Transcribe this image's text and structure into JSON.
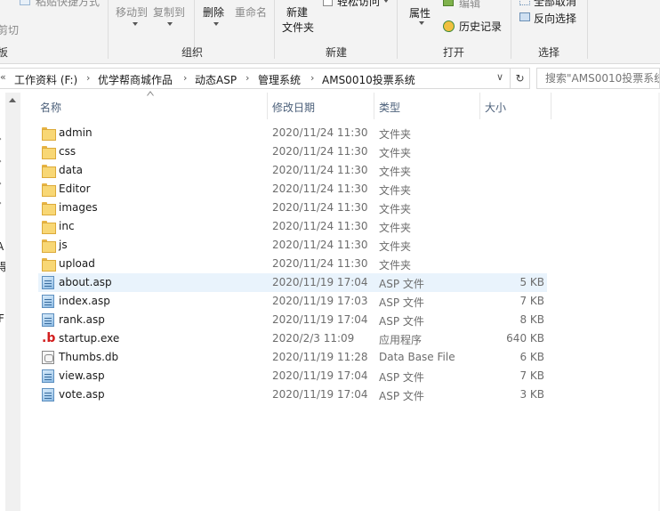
{
  "ribbon": {
    "partial_top_left": "粘贴快捷方式",
    "partial_left_cut": "剪切",
    "partial_left_board": "板",
    "move_to": "移动到",
    "copy_to": "复制到",
    "delete": "删除",
    "rename": "重命名",
    "new_folder_1": "新建",
    "new_folder_2": "文件夹",
    "new_item_partial": "轻松访问",
    "properties": "属性",
    "edit_partial": "编辑",
    "history": "历史记录",
    "select_all_partial": "全部取消",
    "invert_selection": "反向选择",
    "groups": {
      "organize": "组织",
      "new": "新建",
      "open": "打开",
      "select": "选择"
    }
  },
  "address": {
    "prefix": "«",
    "crumbs": [
      "工作资料 (F:)",
      "优学帮商城作品",
      "动态ASP",
      "管理系统",
      "AMS0010投票系统"
    ],
    "separator": "›",
    "dropdown": "∨",
    "refresh": "↻",
    "search_placeholder": "搜索\"AMS0010投票系统"
  },
  "nav": {
    "partial_labels": [
      "A",
      "得",
      "F"
    ]
  },
  "columns": {
    "name": "名称",
    "date": "修改日期",
    "type": "类型",
    "size": "大小"
  },
  "files": [
    {
      "name": "admin",
      "date": "2020/11/24 11:30",
      "type": "文件夹",
      "size": "",
      "icon": "folder-icon"
    },
    {
      "name": "css",
      "date": "2020/11/24 11:30",
      "type": "文件夹",
      "size": "",
      "icon": "folder-icon"
    },
    {
      "name": "data",
      "date": "2020/11/24 11:30",
      "type": "文件夹",
      "size": "",
      "icon": "folder-icon"
    },
    {
      "name": "Editor",
      "date": "2020/11/24 11:30",
      "type": "文件夹",
      "size": "",
      "icon": "folder-icon"
    },
    {
      "name": "images",
      "date": "2020/11/24 11:30",
      "type": "文件夹",
      "size": "",
      "icon": "folder-icon"
    },
    {
      "name": "inc",
      "date": "2020/11/24 11:30",
      "type": "文件夹",
      "size": "",
      "icon": "folder-icon"
    },
    {
      "name": "js",
      "date": "2020/11/24 11:30",
      "type": "文件夹",
      "size": "",
      "icon": "folder-icon"
    },
    {
      "name": "upload",
      "date": "2020/11/24 11:30",
      "type": "文件夹",
      "size": "",
      "icon": "folder-icon"
    },
    {
      "name": "about.asp",
      "date": "2020/11/19 17:04",
      "type": "ASP 文件",
      "size": "5 KB",
      "icon": "asp-file-icon"
    },
    {
      "name": "index.asp",
      "date": "2020/11/19 17:03",
      "type": "ASP 文件",
      "size": "7 KB",
      "icon": "asp-file-icon"
    },
    {
      "name": "rank.asp",
      "date": "2020/11/19 17:04",
      "type": "ASP 文件",
      "size": "8 KB",
      "icon": "asp-file-icon"
    },
    {
      "name": "startup.exe",
      "date": "2020/2/3 11:09",
      "type": "应用程序",
      "size": "640 KB",
      "icon": "exe-app-icon"
    },
    {
      "name": "Thumbs.db",
      "date": "2020/11/19 11:28",
      "type": "Data Base File",
      "size": "6 KB",
      "icon": "database-file-icon"
    },
    {
      "name": "view.asp",
      "date": "2020/11/19 17:04",
      "type": "ASP 文件",
      "size": "7 KB",
      "icon": "asp-file-icon"
    },
    {
      "name": "vote.asp",
      "date": "2020/11/19 17:04",
      "type": "ASP 文件",
      "size": "3 KB",
      "icon": "asp-file-icon"
    }
  ],
  "exe_glyph": ".b"
}
